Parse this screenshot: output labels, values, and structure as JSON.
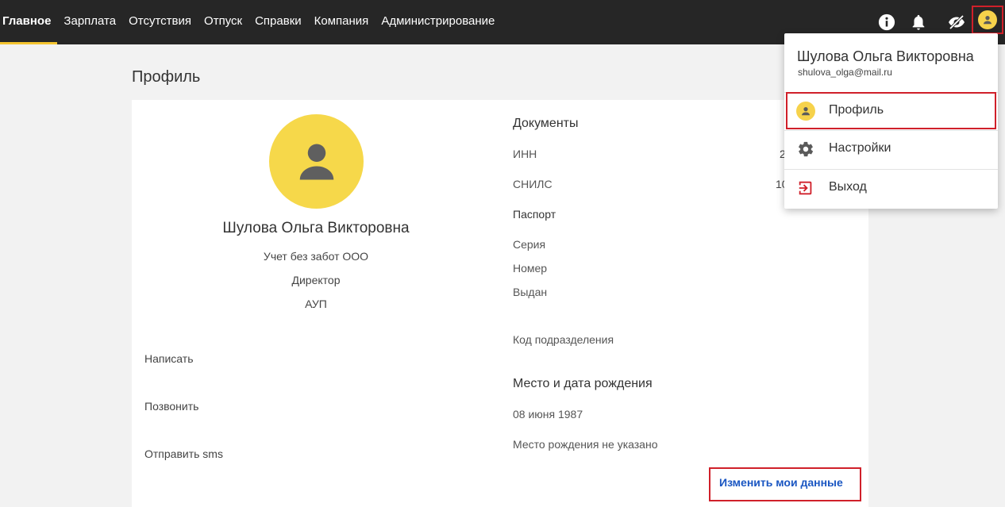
{
  "nav": {
    "items": [
      {
        "label": "Главное"
      },
      {
        "label": "Зарплата"
      },
      {
        "label": "Отсутствия"
      },
      {
        "label": "Отпуск"
      },
      {
        "label": "Справки"
      },
      {
        "label": "Компания"
      },
      {
        "label": "Администрирование"
      }
    ],
    "active_index": 0,
    "accent_color": "#f4c430"
  },
  "top_icons": [
    "info-icon",
    "bell-icon",
    "visibility-off-icon",
    "account-icon"
  ],
  "page": {
    "title": "Профиль"
  },
  "profile": {
    "name": "Шулова Ольга Викторовна",
    "company": "Учет без забот ООО",
    "position": "Директор",
    "department": "АУП",
    "actions": [
      "Написать",
      "Позвонить",
      "Отправить sms"
    ]
  },
  "documents": {
    "title": "Документы",
    "inn_label": "ИНН",
    "inn_value_partial": "2",
    "snils_label": "СНИЛС",
    "snils_value_partial": "10",
    "passport_title": "Паспорт",
    "series_label": "Серия",
    "number_label": "Номер",
    "issued_label": "Выдан",
    "division_code_label": "Код подразделения"
  },
  "birth": {
    "title": "Место и дата рождения",
    "date": "08 июня 1987",
    "place": "Место рождения не указано"
  },
  "edit_link": "Изменить мои данные",
  "dropdown": {
    "name": "Шулова Ольга Викторовна",
    "email": "shulova_olga@mail.ru",
    "items": [
      {
        "label": "Профиль",
        "icon": "account-icon"
      },
      {
        "label": "Настройки",
        "icon": "gear-icon"
      },
      {
        "label": "Выход",
        "icon": "logout-icon"
      }
    ]
  },
  "colors": {
    "topbar": "#262626",
    "avatar": "#f6d84a",
    "highlight": "#d0202a",
    "link": "#1a56c2"
  }
}
